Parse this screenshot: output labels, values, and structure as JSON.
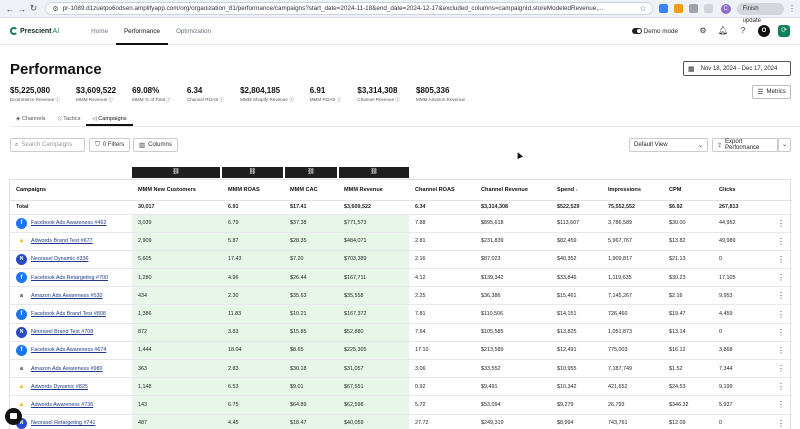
{
  "browser": {
    "url": "pr-1089.d1zuetpo6odsen.amplifyapp.com/org/organization_81/performance/campaigns?start_date=2024-11-18&end_date=2024-12-17&excluded_columns=campaignId,storeModeledRevenue,...",
    "profile_initial": "C",
    "finish_update_label": "Finish update"
  },
  "app": {
    "logo_text": "Prescient",
    "logo_suffix": "AI",
    "nav": [
      "Home",
      "Performance",
      "Optimization"
    ],
    "demo_mode_label": "Demo mode",
    "user_initial": "O"
  },
  "page": {
    "title": "Performance",
    "date_range": "Nov 18, 2024 - Dec 17, 2024",
    "metrics_label": "Metrics"
  },
  "kpis": [
    {
      "value": "$5,225,080",
      "label": "Ecommerce Revenue ⓘ"
    },
    {
      "value": "$3,609,522",
      "label": "MMM Revenue ⓘ"
    },
    {
      "value": "69.08%",
      "label": "MMM % of Total ⓘ"
    },
    {
      "value": "6.34",
      "label": "Channel ROAS ⓘ"
    },
    {
      "value": "$2,804,185",
      "label": "MMM Shopify Revenue ⓘ"
    },
    {
      "value": "6.91",
      "label": "MMM ROAS ⓘ"
    },
    {
      "value": "$3,314,308",
      "label": "Channel Revenue ⓘ"
    },
    {
      "value": "$805,336",
      "label": "MMM Amazon Revenue"
    }
  ],
  "subtabs": [
    "Channels",
    "Tactics",
    "Campaigns"
  ],
  "toolbar": {
    "search_placeholder": "Search Campaigns",
    "filters_label": "0 Filters",
    "columns_label": "Columns",
    "view_label": "Default View",
    "export_label": "Export Performance"
  },
  "table": {
    "headers": [
      "Campaigns",
      "MMM New Customers",
      "MMM ROAS",
      "MMM CAC",
      "MMM Revenue",
      "Channel ROAS",
      "Channel Revenue",
      "Spend",
      "Impressions",
      "CPM",
      "Clicks"
    ],
    "total": [
      "Total",
      "30,017",
      "6.91",
      "$17.41",
      "$3,609,522",
      "6.34",
      "$3,314,308",
      "$522,529",
      "75,552,552",
      "$6.92",
      "267,813"
    ],
    "rows": [
      {
        "logo": "fb",
        "cells": [
          "Facebook Ads Awareness #462",
          "3,039",
          "6.79",
          "$37.38",
          "$771,573",
          "7.88",
          "$895,618",
          "$113,607",
          "3,786,589",
          "$30.00",
          "44,952"
        ]
      },
      {
        "logo": "ad",
        "cells": [
          "Adwords Brand Test #677",
          "2,909",
          "5.87",
          "$28.35",
          "$484,071",
          "2.81",
          "$231,839",
          "$82,459",
          "5,967,767",
          "$13.82",
          "49,989"
        ]
      },
      {
        "logo": "np",
        "cells": [
          "Neoraxel Dynamic #336",
          "5,605",
          "17.43",
          "$7.20",
          "$703,389",
          "2.16",
          "$87,023",
          "$40,352",
          "1,909,817",
          "$21.13",
          "0"
        ]
      },
      {
        "logo": "fb",
        "cells": [
          "Facebook Ads Retargeting #700",
          "1,280",
          "4.96",
          "$26.44",
          "$167,711",
          "4.12",
          "$139,342",
          "$33,846",
          "1,119,635",
          "$30.23",
          "17,105"
        ]
      },
      {
        "logo": "amz",
        "cells": [
          "Amazon Ads Awareness #530",
          "434",
          "2.30",
          "$35.63",
          "$35,558",
          "2.25",
          "$36,386",
          "$15,461",
          "7,145,267",
          "$2.16",
          "9,953"
        ]
      },
      {
        "logo": "fb",
        "cells": [
          "Facebook Ads Brand Test #808",
          "1,386",
          "11.83",
          "$10.21",
          "$167,372",
          "7.81",
          "$110,506",
          "$14,151",
          "726,460",
          "$19.47",
          "4,459"
        ]
      },
      {
        "logo": "np",
        "cells": [
          "Neoraxel Brand Test #708",
          "872",
          "3.83",
          "$15.85",
          "$52,880",
          "7.64",
          "$105,585",
          "$13,825",
          "1,051,873",
          "$13.14",
          "0"
        ]
      },
      {
        "logo": "fb",
        "cells": [
          "Facebook Ads Awareness #674",
          "1,444",
          "18.04",
          "$8.65",
          "$225,305",
          "17.10",
          "$213,589",
          "$12,491",
          "775,003",
          "$16.12",
          "3,868"
        ]
      },
      {
        "logo": "amz",
        "cells": [
          "Amazon Ads Awareness #980",
          "363",
          "2.83",
          "$30.18",
          "$31,057",
          "3.06",
          "$33,552",
          "$10,955",
          "7,187,749",
          "$1.52",
          "7,344"
        ]
      },
      {
        "logo": "ad",
        "cells": [
          "Adwords Dynamic #825",
          "1,148",
          "6.53",
          "$9.01",
          "$67,551",
          "0.92",
          "$9,491",
          "$10,342",
          "421,652",
          "$24.53",
          "9,199"
        ]
      },
      {
        "logo": "ad",
        "cells": [
          "Adwords Awareness #736",
          "143",
          "6.75",
          "$64.89",
          "$62,598",
          "5.72",
          "$53,094",
          "$9,279",
          "26,793",
          "$346.32",
          "5,937"
        ]
      },
      {
        "logo": "np",
        "cells": [
          "Neoraxel Retargeting #741",
          "487",
          "4.45",
          "$18.47",
          "$40,059",
          "27.72",
          "$249,319",
          "$8,994",
          "743,761",
          "$12.09",
          "0"
        ]
      }
    ]
  }
}
